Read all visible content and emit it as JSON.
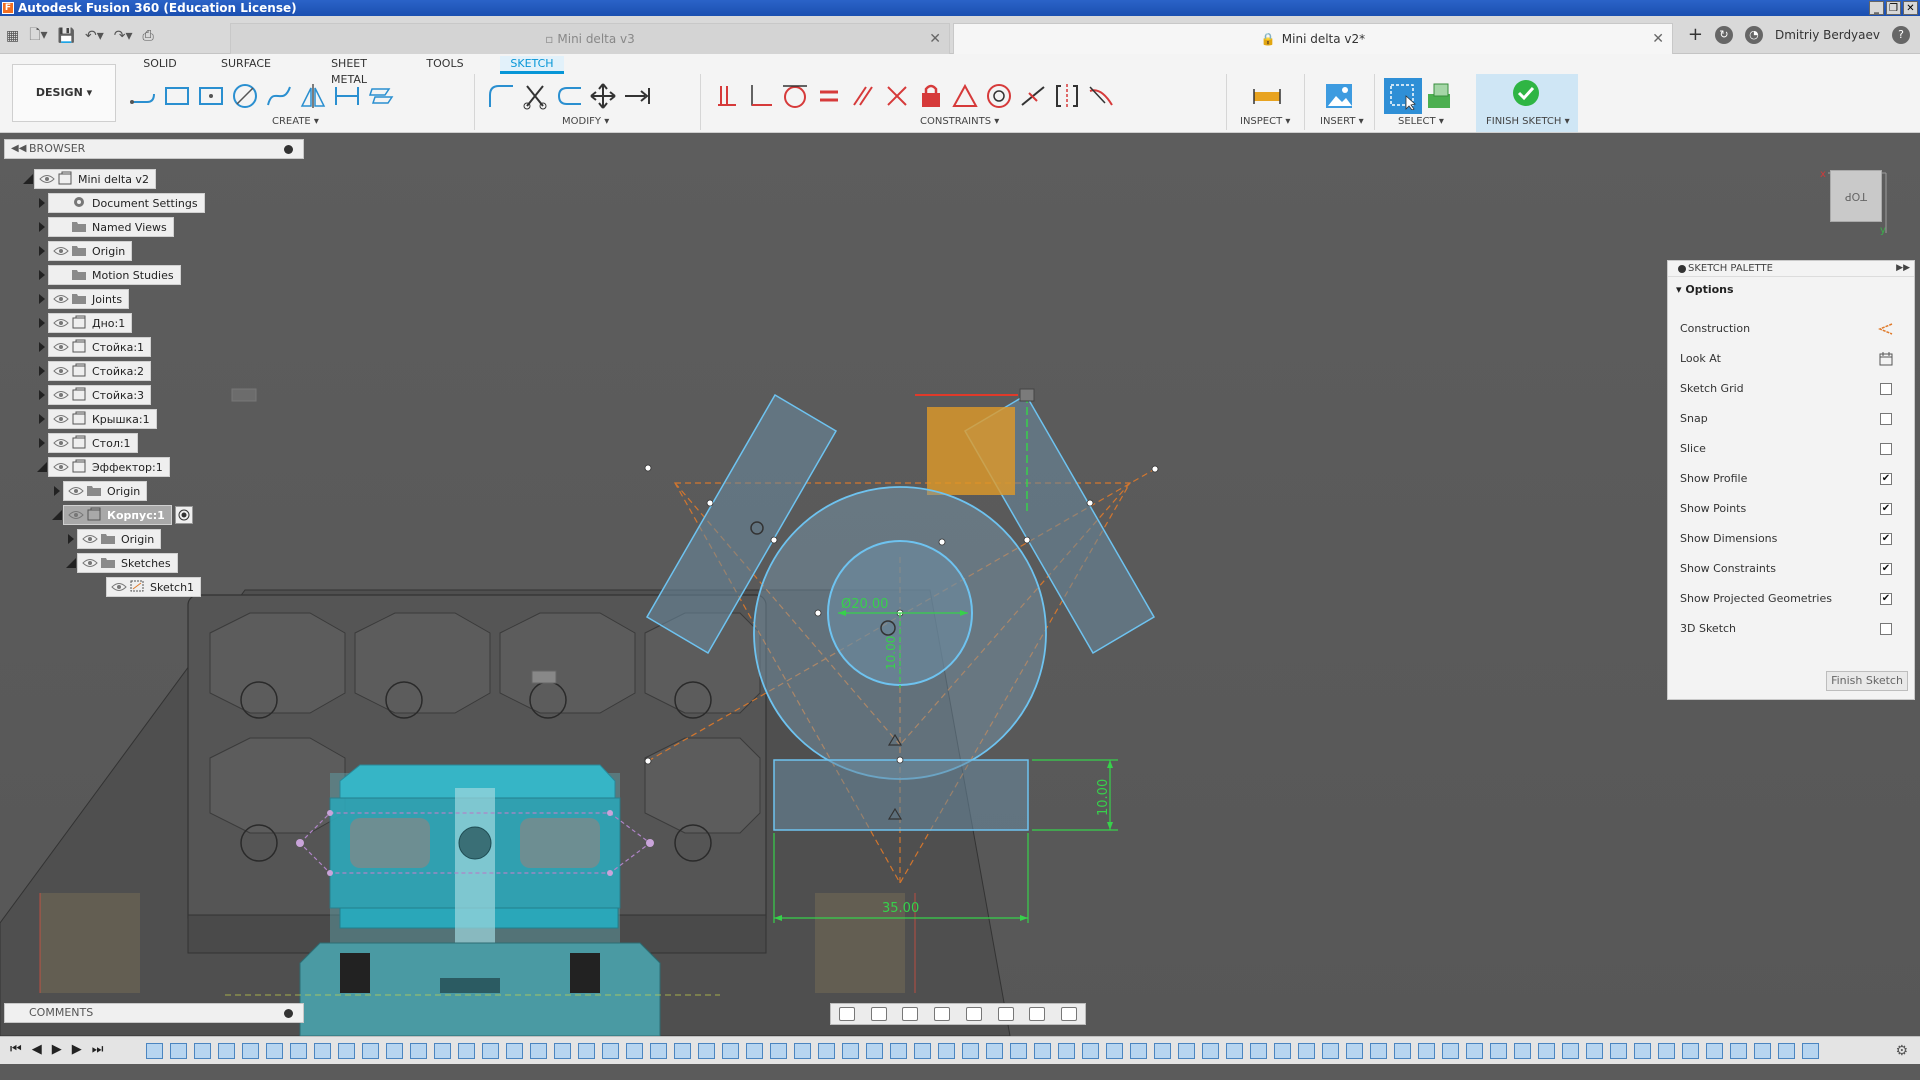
{
  "window": {
    "title": "Autodesk Fusion 360 (Education License)",
    "controls": [
      "_",
      "❐",
      "✕"
    ]
  },
  "doc_tabs": [
    {
      "label": "Mini delta v3",
      "active": false
    },
    {
      "label": "Mini delta v2*",
      "active": true
    }
  ],
  "user": {
    "name": "Dmitriy Berdyaev"
  },
  "ribbon": {
    "workspace": "DESIGN ▾",
    "tabs": [
      "SOLID",
      "SURFACE",
      "SHEET METAL",
      "TOOLS",
      "SKETCH"
    ],
    "active_tab": "SKETCH",
    "groups": {
      "create": "CREATE ▾",
      "modify": "MODIFY ▾",
      "constraints": "CONSTRAINTS ▾",
      "inspect": "INSPECT ▾",
      "insert": "INSERT ▾",
      "select": "SELECT ▾",
      "finish": "FINISH SKETCH ▾"
    }
  },
  "browser": {
    "title": "BROWSER",
    "items": [
      {
        "label": "Mini delta v2",
        "icon": "component-icon"
      },
      {
        "label": "Document Settings",
        "icon": "gear-icon"
      },
      {
        "label": "Named Views",
        "icon": "folder-icon"
      },
      {
        "label": "Origin",
        "icon": "folder-icon"
      },
      {
        "label": "Motion Studies",
        "icon": "folder-icon"
      },
      {
        "label": "Joints",
        "icon": "folder-icon"
      },
      {
        "label": "Дно:1",
        "icon": "component-icon"
      },
      {
        "label": "Стойка:1",
        "icon": "component-icon"
      },
      {
        "label": "Стойка:2",
        "icon": "component-icon"
      },
      {
        "label": "Стойка:3",
        "icon": "component-icon"
      },
      {
        "label": "Крышка:1",
        "icon": "component-icon"
      },
      {
        "label": "Стол:1",
        "icon": "component-icon"
      },
      {
        "label": "Эффектор:1",
        "icon": "component-icon"
      },
      {
        "label": "Origin",
        "icon": "folder-icon"
      },
      {
        "label": "Корпус:1",
        "icon": "component-icon"
      },
      {
        "label": "Origin",
        "icon": "folder-icon"
      },
      {
        "label": "Sketches",
        "icon": "folder-icon"
      },
      {
        "label": "Sketch1",
        "icon": "sketch-icon"
      }
    ]
  },
  "comments": {
    "title": "COMMENTS"
  },
  "viewcube": {
    "face": "TOP"
  },
  "palette": {
    "title": "SKETCH PALETTE",
    "section": "Options",
    "rows": [
      {
        "label": "Construction",
        "type": "icon",
        "icon": "construction-icon"
      },
      {
        "label": "Look At",
        "type": "icon",
        "icon": "look-at-icon"
      },
      {
        "label": "Sketch Grid",
        "type": "check",
        "checked": false
      },
      {
        "label": "Snap",
        "type": "check",
        "checked": false
      },
      {
        "label": "Slice",
        "type": "check",
        "checked": false
      },
      {
        "label": "Show Profile",
        "type": "check",
        "checked": true
      },
      {
        "label": "Show Points",
        "type": "check",
        "checked": true
      },
      {
        "label": "Show Dimensions",
        "type": "check",
        "checked": true
      },
      {
        "label": "Show Constraints",
        "type": "check",
        "checked": true
      },
      {
        "label": "Show Projected Geometries",
        "type": "check",
        "checked": true
      },
      {
        "label": "3D Sketch",
        "type": "check",
        "checked": false
      }
    ],
    "finish_button": "Finish Sketch"
  },
  "dimensions": {
    "diameter": "Ø20.00",
    "vertical_small": "10.00",
    "height": "10.00",
    "width": "35.00"
  },
  "timeline": {
    "controls": [
      "⏮",
      "◀",
      "▶",
      "▶",
      "⏭"
    ],
    "gear": "⚙"
  },
  "colors": {
    "accent": "#0696d7",
    "sketch_line": "#6ec3f0",
    "construction": "#e07a2a",
    "dimension": "#37d14b",
    "finish_check": "#2fb544"
  }
}
